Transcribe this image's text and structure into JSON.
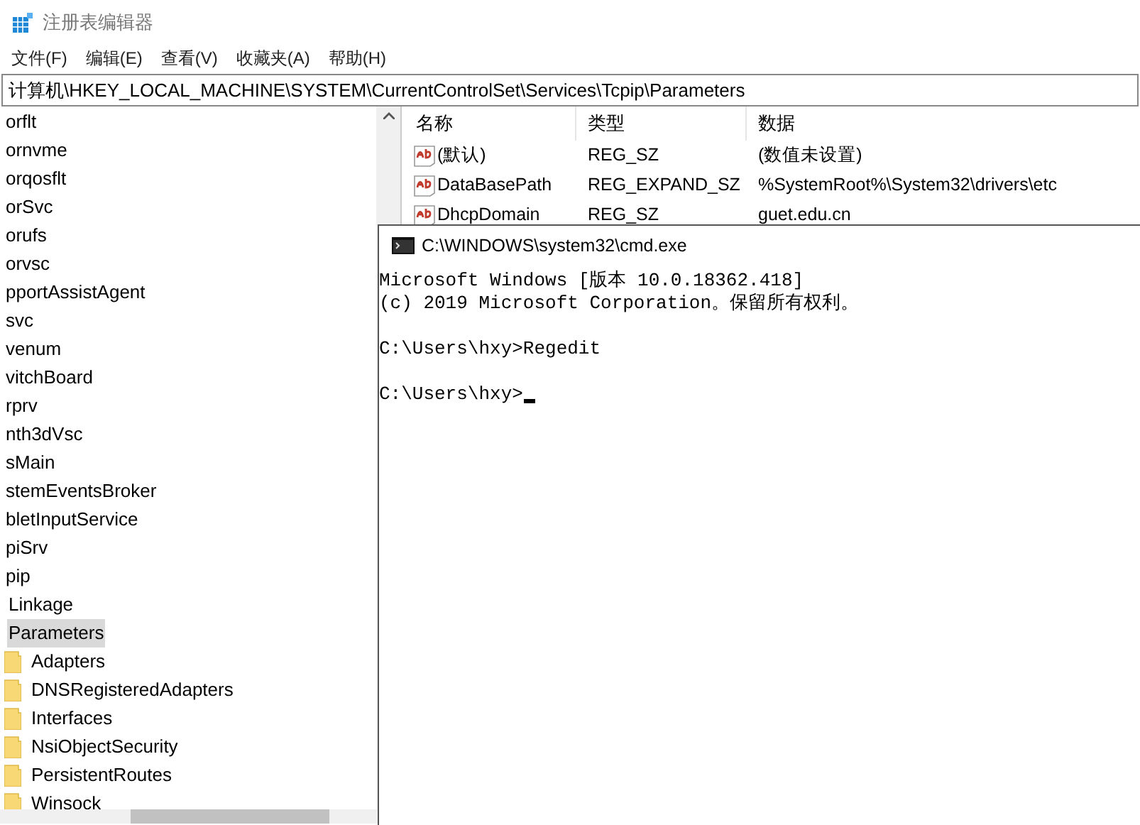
{
  "window": {
    "title": "注册表编辑器"
  },
  "menu": [
    "文件(F)",
    "编辑(E)",
    "查看(V)",
    "收藏夹(A)",
    "帮助(H)"
  ],
  "address": "计算机\\HKEY_LOCAL_MACHINE\\SYSTEM\\CurrentControlSet\\Services\\Tcpip\\Parameters",
  "tree": [
    {
      "label": "orflt",
      "selected": false
    },
    {
      "label": "ornvme",
      "selected": false
    },
    {
      "label": "orqosflt",
      "selected": false
    },
    {
      "label": "orSvc",
      "selected": false
    },
    {
      "label": "orufs",
      "selected": false
    },
    {
      "label": "orvsc",
      "selected": false
    },
    {
      "label": "pportAssistAgent",
      "selected": false
    },
    {
      "label": "svc",
      "selected": false
    },
    {
      "label": "venum",
      "selected": false
    },
    {
      "label": "vitchBoard",
      "selected": false
    },
    {
      "label": "rprv",
      "selected": false
    },
    {
      "label": "nth3dVsc",
      "selected": false
    },
    {
      "label": "sMain",
      "selected": false
    },
    {
      "label": "stemEventsBroker",
      "selected": false
    },
    {
      "label": "bletInputService",
      "selected": false
    },
    {
      "label": "piSrv",
      "selected": false
    },
    {
      "label": "pip",
      "selected": false,
      "children": [
        {
          "label": "Linkage",
          "selected": false
        },
        {
          "label": "Parameters",
          "selected": true,
          "children": [
            {
              "label": "Adapters",
              "selected": false
            },
            {
              "label": "DNSRegisteredAdapters",
              "selected": false
            },
            {
              "label": "Interfaces",
              "selected": false
            },
            {
              "label": "NsiObjectSecurity",
              "selected": false
            },
            {
              "label": "PersistentRoutes",
              "selected": false
            },
            {
              "label": "Winsock",
              "selected": false
            }
          ]
        }
      ]
    }
  ],
  "values": {
    "columns": [
      "名称",
      "类型",
      "数据"
    ],
    "rows": [
      {
        "name": "(默认)",
        "type": "REG_SZ",
        "data": "(数值未设置)"
      },
      {
        "name": "DataBasePath",
        "type": "REG_EXPAND_SZ",
        "data": "%SystemRoot%\\System32\\drivers\\etc"
      },
      {
        "name": "DhcpDomain",
        "type": "REG_SZ",
        "data": "guet.edu.cn"
      }
    ]
  },
  "console": {
    "title": "C:\\WINDOWS\\system32\\cmd.exe",
    "lines": [
      {
        "text": "Microsoft Windows [版本 10.0.18362.418]",
        "blank_after": false
      },
      {
        "text": "(c) 2019 Microsoft Corporation。保留所有权利。",
        "blank_after": true
      },
      {
        "text": "C:\\Users\\hxy>Regedit",
        "blank_after": true
      },
      {
        "text": "C:\\Users\\hxy>",
        "blank_after": false
      }
    ]
  }
}
